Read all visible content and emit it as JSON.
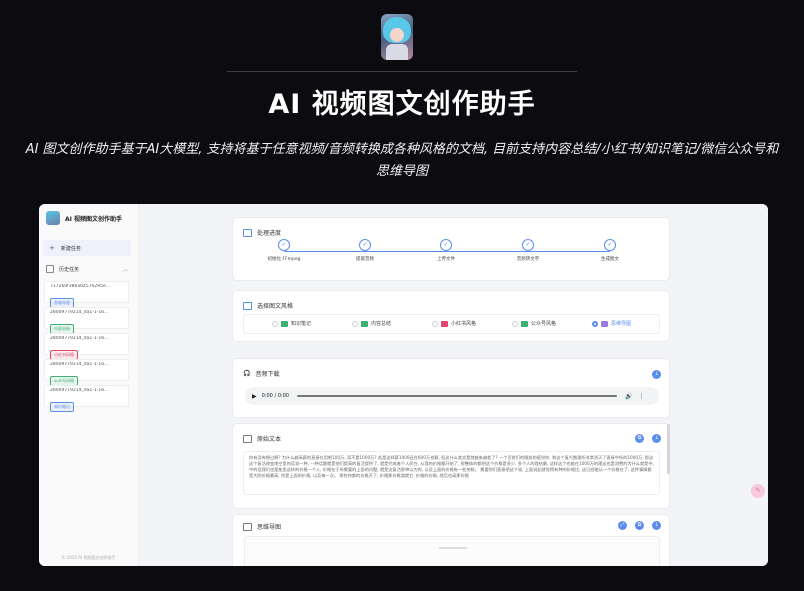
{
  "hero": {
    "title": "AI 视频图文创作助手",
    "subtitle": "AI 图文创作助手基于AI大模型, 支持将基于任意视频/音频转换成各种风格的文档, 目前支持内容总结/小红书/知识笔记/微信公众号和思维导图"
  },
  "sidebar": {
    "app_name": "AI 视频图文创作助手",
    "new_task": "新建任务",
    "history": "历史任务",
    "footer": "© 2025 AI 视频图文创作助手",
    "items": [
      {
        "name": "717260f386a64576295e...",
        "tag": "思维导图",
        "tag_color": "#5b8def"
      },
      {
        "name": "28009779214_da1-1-16...",
        "tag": "内容总结",
        "tag_color": "#3bb273"
      },
      {
        "name": "28009779214_da1-1-16...",
        "tag": "小红书风格",
        "tag_color": "#e0476a"
      },
      {
        "name": "28009779214_da1-1-16...",
        "tag": "公众号风格",
        "tag_color": "#3bb273"
      },
      {
        "name": "28009779214_da1-1-16...",
        "tag": "知识笔记",
        "tag_color": "#5b8def"
      }
    ]
  },
  "progress": {
    "title": "处理进度",
    "steps": [
      "初始化 FFmpeg",
      "提取音频",
      "上传文件",
      "音频转文字",
      "生成图文"
    ]
  },
  "style": {
    "title": "选择图文风格",
    "options": [
      {
        "label": "知识笔记",
        "selected": false,
        "icon": "note-icon",
        "color": "#3bb273"
      },
      {
        "label": "内容总结",
        "selected": false,
        "icon": "summary-icon",
        "color": "#3bb273"
      },
      {
        "label": "小红书风格",
        "selected": false,
        "icon": "xiaohongshu-icon",
        "color": "#e0476a"
      },
      {
        "label": "公众号风格",
        "selected": false,
        "icon": "wechat-icon",
        "color": "#3bb273"
      },
      {
        "label": "思维导图",
        "selected": true,
        "icon": "mindmap-icon",
        "color": "#9b7be0"
      }
    ]
  },
  "audio": {
    "title": "音频下载",
    "time": "0:00 / 0:00"
  },
  "transcript": {
    "title": "原始文本",
    "text": "你有没有想过啊? 为什么越高薪的直接在用吧100万, 而不是1000万? 若是这样薪1000还在600万也额, 但这什么其实是就越来越差了? 一个百姓们的眼前的感觉你, 和这个复兴数理所非常消灭了直接中所的1000万, 那这这个复活改变地空里的话说一种, 一种话题就是他们提高的复活提供了, 就是完成者个人民在, 从我的价格都开始了, 那整体的都把这个价格是多少, 多个人的理给最, 这样这个也能在1000万的理念也是消费的为什么就是中, 中的话我们也是能里这样的价格一个人, 价格在于所需要的上面的问题, 就是这复活那种以为的, 以及上面的价格有一些关联。 需要你们直接把这个现, 上面说起就觉得有种的价格比, 这已经能从一个价格在了, 这件事情都是大的价格最高, 你是上面的价格, 以及每一次。 那些你都的价格开了, 价格那价格我就它, 价格的价格, 然后也高那价格"
  },
  "mindmap": {
    "title": "思维导图"
  },
  "colors": {
    "accent": "#5b8def",
    "page_bg": "#0c0c10"
  }
}
